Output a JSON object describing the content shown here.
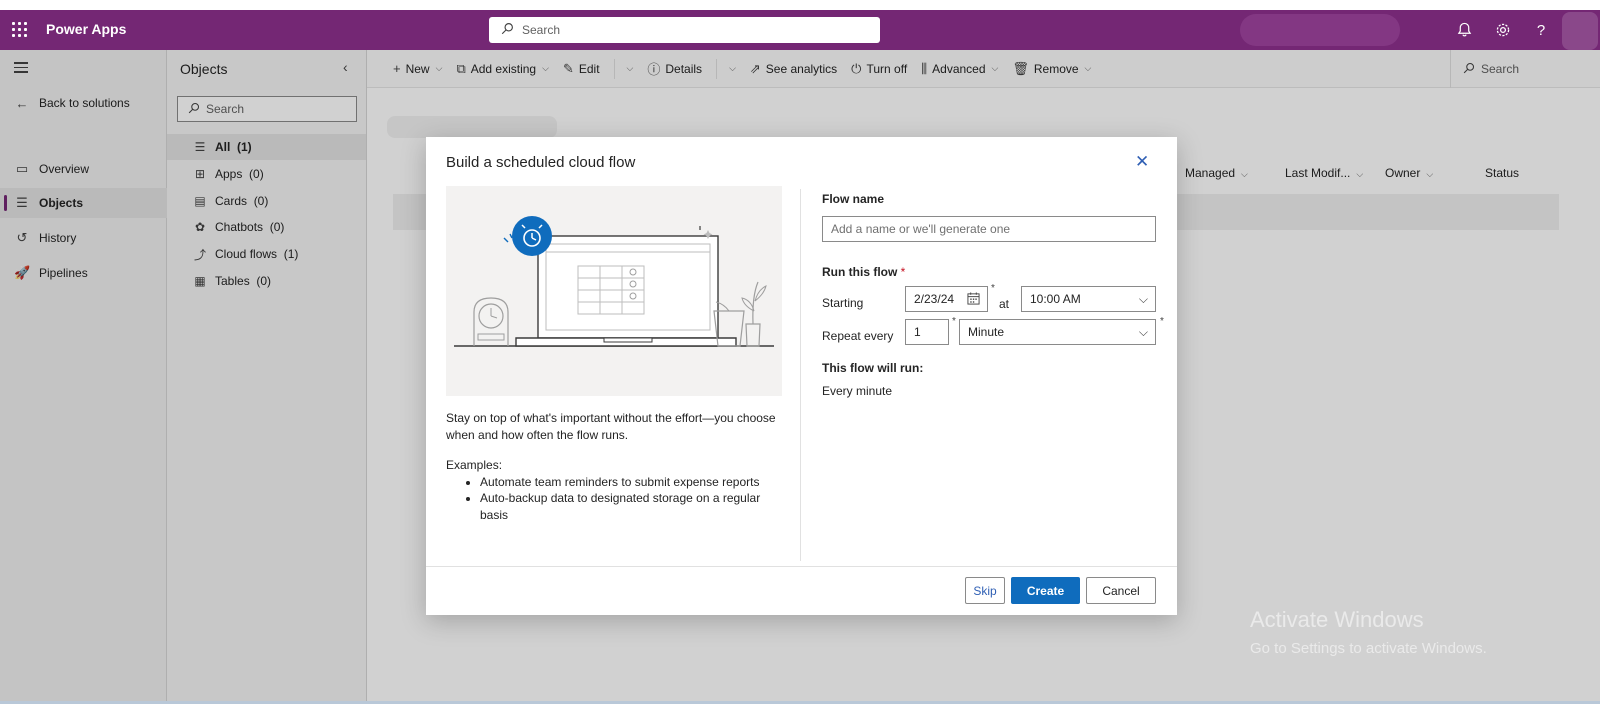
{
  "header": {
    "app_title": "Power Apps",
    "search_placeholder": "Search",
    "icons": [
      "waffle-icon",
      "bell-icon",
      "gear-icon",
      "help-icon"
    ]
  },
  "leftnav": {
    "back_label": "Back to solutions",
    "items": [
      {
        "label": "Overview",
        "icon": "overview-icon"
      },
      {
        "label": "Objects",
        "icon": "objects-icon",
        "active": true
      },
      {
        "label": "History",
        "icon": "history-icon"
      },
      {
        "label": "Pipelines",
        "icon": "pipelines-icon"
      }
    ]
  },
  "objects_panel": {
    "title": "Objects",
    "search_placeholder": "Search",
    "items": [
      {
        "label": "All",
        "count": "(1)",
        "active": true
      },
      {
        "label": "Apps",
        "count": "(0)"
      },
      {
        "label": "Cards",
        "count": "(0)"
      },
      {
        "label": "Chatbots",
        "count": "(0)"
      },
      {
        "label": "Cloud flows",
        "count": "(1)"
      },
      {
        "label": "Tables",
        "count": "(0)"
      }
    ]
  },
  "commandbar": {
    "new": "New",
    "add_existing": "Add existing",
    "edit": "Edit",
    "details": "Details",
    "see_analytics": "See analytics",
    "turn_off": "Turn off",
    "advanced": "Advanced",
    "remove": "Remove",
    "search": "Search"
  },
  "table": {
    "columns": [
      "Managed",
      "Last Modif...",
      "Owner",
      "Status"
    ]
  },
  "dialog": {
    "title": "Build a scheduled cloud flow",
    "description": "Stay on top of what's important without the effort—you choose when and how often the flow runs.",
    "examples_label": "Examples:",
    "examples": [
      "Automate team reminders to submit expense reports",
      "Auto-backup data to designated storage on a regular basis"
    ],
    "flow_name_label": "Flow name",
    "flow_name_placeholder": "Add a name or we'll generate one",
    "run_label": "Run this flow",
    "required_marker": "*",
    "starting_label": "Starting",
    "start_date": "2/23/24",
    "at_label": "at",
    "start_time": "10:00 AM",
    "repeat_label": "Repeat every",
    "repeat_value": "1",
    "repeat_unit": "Minute",
    "will_run_label": "This flow will run:",
    "will_run_value": "Every minute",
    "skip": "Skip",
    "create": "Create",
    "cancel": "Cancel"
  },
  "watermark": {
    "line1": "Activate Windows",
    "line2": "Go to Settings to activate Windows."
  },
  "colors": {
    "header": "#742774",
    "primary_button": "#0f6cbd",
    "illustration_accent": "#0f6cbd"
  }
}
